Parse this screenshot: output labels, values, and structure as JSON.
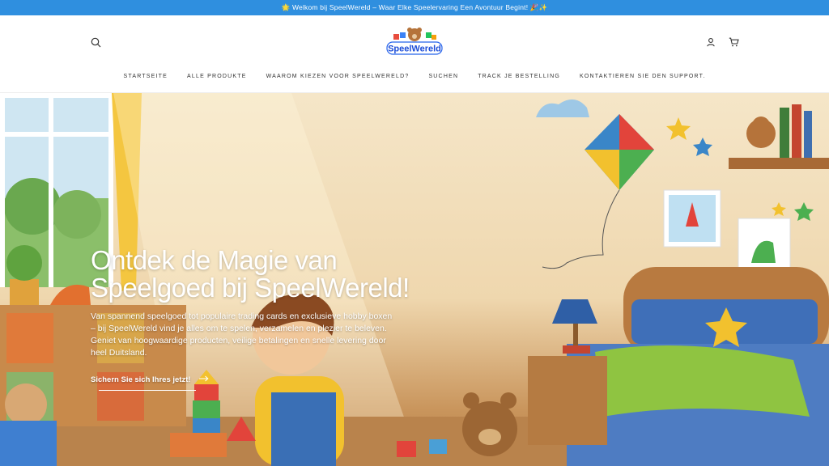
{
  "announcement": {
    "text": "🌟 Welkom bij SpeelWereld – Waar Elke Speelervaring Een Avontuur Begint! 🎉✨"
  },
  "header": {
    "logo_text": "SpeelWereld",
    "icons": {
      "search": "search-icon",
      "account": "user-icon",
      "cart": "cart-icon"
    }
  },
  "nav": {
    "items": [
      "STARTSEITE",
      "ALLE PRODUKTE",
      "WAAROM KIEZEN VOOR SPEELWERELD?",
      "SUCHEN",
      "TRACK JE BESTELLING",
      "KONTAKTIEREN SIE DEN SUPPORT."
    ]
  },
  "hero": {
    "title": "Ontdek de Magie van Speelgoed bij SpeelWereld!",
    "text": "Van spannend speelgoed tot populaire trading cards en exclusieve hobby boxen – bij SpeelWereld vind je alles om te spelen, verzamelen en plezier te beleven. Geniet van hoogwaardige producten, veilige betalingen en snelle levering door heel Duitsland.",
    "cta_label": "Sichern Sie sich Ihres jetzt!"
  },
  "colors": {
    "announcement_bg": "#2f8fdf",
    "text_dark": "#333333",
    "hero_text": "#ffffff"
  }
}
